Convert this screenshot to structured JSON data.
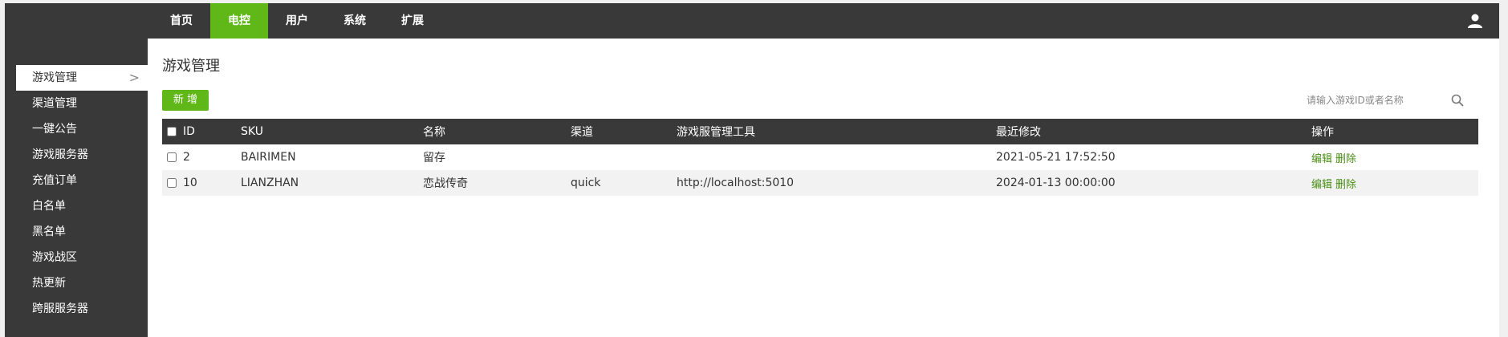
{
  "nav": {
    "items": [
      {
        "label": "首页",
        "active": false
      },
      {
        "label": "电控",
        "active": true
      },
      {
        "label": "用户",
        "active": false
      },
      {
        "label": "系统",
        "active": false
      },
      {
        "label": "扩展",
        "active": false
      }
    ],
    "user_icon": "user-icon"
  },
  "sidebar": {
    "items": [
      {
        "label": "游戏管理",
        "active": true,
        "chevron": ">"
      },
      {
        "label": "渠道管理"
      },
      {
        "label": "一键公告"
      },
      {
        "label": "游戏服务器"
      },
      {
        "label": "充值订单"
      },
      {
        "label": "白名单"
      },
      {
        "label": "黑名单"
      },
      {
        "label": "游戏战区"
      },
      {
        "label": "热更新"
      },
      {
        "label": "跨服服务器"
      }
    ]
  },
  "main": {
    "title": "游戏管理",
    "add_label": "新 增",
    "search": {
      "placeholder": "请输入游戏ID或者名称",
      "value": "",
      "icon": "search-icon"
    },
    "table": {
      "headers": [
        "ID",
        "SKU",
        "名称",
        "渠道",
        "游戏服管理工具",
        "最近修改",
        "操作"
      ],
      "rows": [
        {
          "id": "2",
          "sku": "BAIRIMEN",
          "name": "留存",
          "channel": "",
          "tool": "",
          "modified": "2021-05-21 17:52:50",
          "edit": "编辑",
          "del": "删除"
        },
        {
          "id": "10",
          "sku": "LIANZHAN",
          "name": "恋战传奇",
          "channel": "quick",
          "tool": "http://localhost:5010",
          "modified": "2024-01-13 00:00:00",
          "edit": "编辑",
          "del": "删除"
        }
      ]
    }
  },
  "colors": {
    "accent": "#5fb818",
    "dark": "#393939",
    "link": "#4a8f16"
  }
}
